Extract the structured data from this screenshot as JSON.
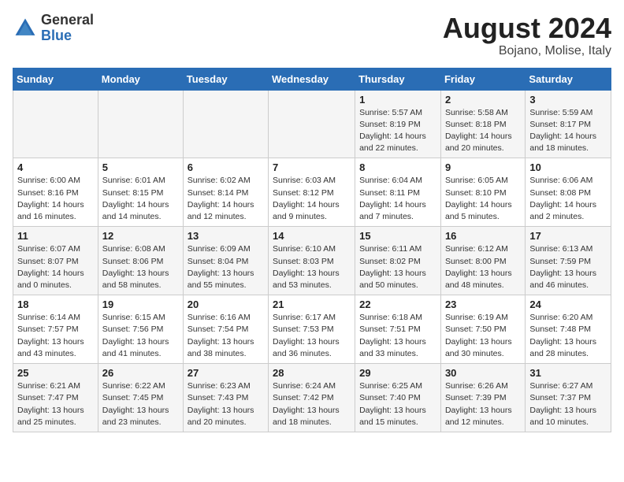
{
  "header": {
    "logo": {
      "general": "General",
      "blue": "Blue"
    },
    "month_year": "August 2024",
    "location": "Bojano, Molise, Italy"
  },
  "days_of_week": [
    "Sunday",
    "Monday",
    "Tuesday",
    "Wednesday",
    "Thursday",
    "Friday",
    "Saturday"
  ],
  "weeks": [
    [
      {
        "num": "",
        "info": ""
      },
      {
        "num": "",
        "info": ""
      },
      {
        "num": "",
        "info": ""
      },
      {
        "num": "",
        "info": ""
      },
      {
        "num": "1",
        "info": "Sunrise: 5:57 AM\nSunset: 8:19 PM\nDaylight: 14 hours\nand 22 minutes."
      },
      {
        "num": "2",
        "info": "Sunrise: 5:58 AM\nSunset: 8:18 PM\nDaylight: 14 hours\nand 20 minutes."
      },
      {
        "num": "3",
        "info": "Sunrise: 5:59 AM\nSunset: 8:17 PM\nDaylight: 14 hours\nand 18 minutes."
      }
    ],
    [
      {
        "num": "4",
        "info": "Sunrise: 6:00 AM\nSunset: 8:16 PM\nDaylight: 14 hours\nand 16 minutes."
      },
      {
        "num": "5",
        "info": "Sunrise: 6:01 AM\nSunset: 8:15 PM\nDaylight: 14 hours\nand 14 minutes."
      },
      {
        "num": "6",
        "info": "Sunrise: 6:02 AM\nSunset: 8:14 PM\nDaylight: 14 hours\nand 12 minutes."
      },
      {
        "num": "7",
        "info": "Sunrise: 6:03 AM\nSunset: 8:12 PM\nDaylight: 14 hours\nand 9 minutes."
      },
      {
        "num": "8",
        "info": "Sunrise: 6:04 AM\nSunset: 8:11 PM\nDaylight: 14 hours\nand 7 minutes."
      },
      {
        "num": "9",
        "info": "Sunrise: 6:05 AM\nSunset: 8:10 PM\nDaylight: 14 hours\nand 5 minutes."
      },
      {
        "num": "10",
        "info": "Sunrise: 6:06 AM\nSunset: 8:08 PM\nDaylight: 14 hours\nand 2 minutes."
      }
    ],
    [
      {
        "num": "11",
        "info": "Sunrise: 6:07 AM\nSunset: 8:07 PM\nDaylight: 14 hours\nand 0 minutes."
      },
      {
        "num": "12",
        "info": "Sunrise: 6:08 AM\nSunset: 8:06 PM\nDaylight: 13 hours\nand 58 minutes."
      },
      {
        "num": "13",
        "info": "Sunrise: 6:09 AM\nSunset: 8:04 PM\nDaylight: 13 hours\nand 55 minutes."
      },
      {
        "num": "14",
        "info": "Sunrise: 6:10 AM\nSunset: 8:03 PM\nDaylight: 13 hours\nand 53 minutes."
      },
      {
        "num": "15",
        "info": "Sunrise: 6:11 AM\nSunset: 8:02 PM\nDaylight: 13 hours\nand 50 minutes."
      },
      {
        "num": "16",
        "info": "Sunrise: 6:12 AM\nSunset: 8:00 PM\nDaylight: 13 hours\nand 48 minutes."
      },
      {
        "num": "17",
        "info": "Sunrise: 6:13 AM\nSunset: 7:59 PM\nDaylight: 13 hours\nand 46 minutes."
      }
    ],
    [
      {
        "num": "18",
        "info": "Sunrise: 6:14 AM\nSunset: 7:57 PM\nDaylight: 13 hours\nand 43 minutes."
      },
      {
        "num": "19",
        "info": "Sunrise: 6:15 AM\nSunset: 7:56 PM\nDaylight: 13 hours\nand 41 minutes."
      },
      {
        "num": "20",
        "info": "Sunrise: 6:16 AM\nSunset: 7:54 PM\nDaylight: 13 hours\nand 38 minutes."
      },
      {
        "num": "21",
        "info": "Sunrise: 6:17 AM\nSunset: 7:53 PM\nDaylight: 13 hours\nand 36 minutes."
      },
      {
        "num": "22",
        "info": "Sunrise: 6:18 AM\nSunset: 7:51 PM\nDaylight: 13 hours\nand 33 minutes."
      },
      {
        "num": "23",
        "info": "Sunrise: 6:19 AM\nSunset: 7:50 PM\nDaylight: 13 hours\nand 30 minutes."
      },
      {
        "num": "24",
        "info": "Sunrise: 6:20 AM\nSunset: 7:48 PM\nDaylight: 13 hours\nand 28 minutes."
      }
    ],
    [
      {
        "num": "25",
        "info": "Sunrise: 6:21 AM\nSunset: 7:47 PM\nDaylight: 13 hours\nand 25 minutes."
      },
      {
        "num": "26",
        "info": "Sunrise: 6:22 AM\nSunset: 7:45 PM\nDaylight: 13 hours\nand 23 minutes."
      },
      {
        "num": "27",
        "info": "Sunrise: 6:23 AM\nSunset: 7:43 PM\nDaylight: 13 hours\nand 20 minutes."
      },
      {
        "num": "28",
        "info": "Sunrise: 6:24 AM\nSunset: 7:42 PM\nDaylight: 13 hours\nand 18 minutes."
      },
      {
        "num": "29",
        "info": "Sunrise: 6:25 AM\nSunset: 7:40 PM\nDaylight: 13 hours\nand 15 minutes."
      },
      {
        "num": "30",
        "info": "Sunrise: 6:26 AM\nSunset: 7:39 PM\nDaylight: 13 hours\nand 12 minutes."
      },
      {
        "num": "31",
        "info": "Sunrise: 6:27 AM\nSunset: 7:37 PM\nDaylight: 13 hours\nand 10 minutes."
      }
    ]
  ]
}
